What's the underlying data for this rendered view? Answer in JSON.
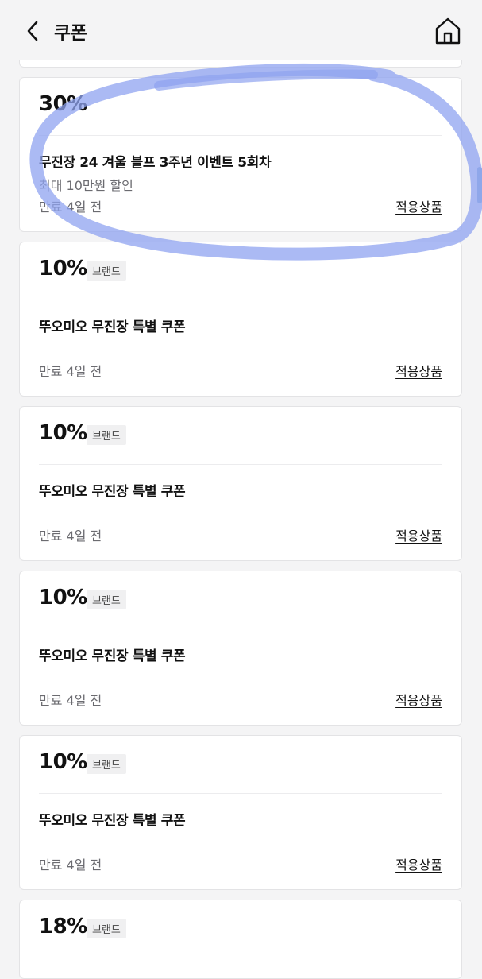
{
  "header": {
    "title": "쿠폰"
  },
  "icons": {
    "back": "chevron-left-icon",
    "home": "home-icon"
  },
  "coupons": [
    {
      "discount": "30%",
      "badge": "",
      "name": "무진장 24 겨울 블프 3주년 이벤트 5회차",
      "sub": "최대 10만원 할인",
      "expiry": "만료 4일 전",
      "link": "적용상품"
    },
    {
      "discount": "10%",
      "badge": "브랜드",
      "name": "뚜오미오 무진장 특별 쿠폰",
      "sub": "",
      "expiry": "만료 4일 전",
      "link": "적용상품"
    },
    {
      "discount": "10%",
      "badge": "브랜드",
      "name": "뚜오미오 무진장 특별 쿠폰",
      "sub": "",
      "expiry": "만료 4일 전",
      "link": "적용상품"
    },
    {
      "discount": "10%",
      "badge": "브랜드",
      "name": "뚜오미오 무진장 특별 쿠폰",
      "sub": "",
      "expiry": "만료 4일 전",
      "link": "적용상품"
    },
    {
      "discount": "10%",
      "badge": "브랜드",
      "name": "뚜오미오 무진장 특별 쿠폰",
      "sub": "",
      "expiry": "만료 4일 전",
      "link": "적용상품"
    },
    {
      "discount": "18%",
      "badge": "브랜드",
      "name": "",
      "sub": "",
      "expiry": "",
      "link": ""
    }
  ],
  "colors": {
    "background": "#f4f4f5",
    "highlight": "#8fa3f0"
  }
}
